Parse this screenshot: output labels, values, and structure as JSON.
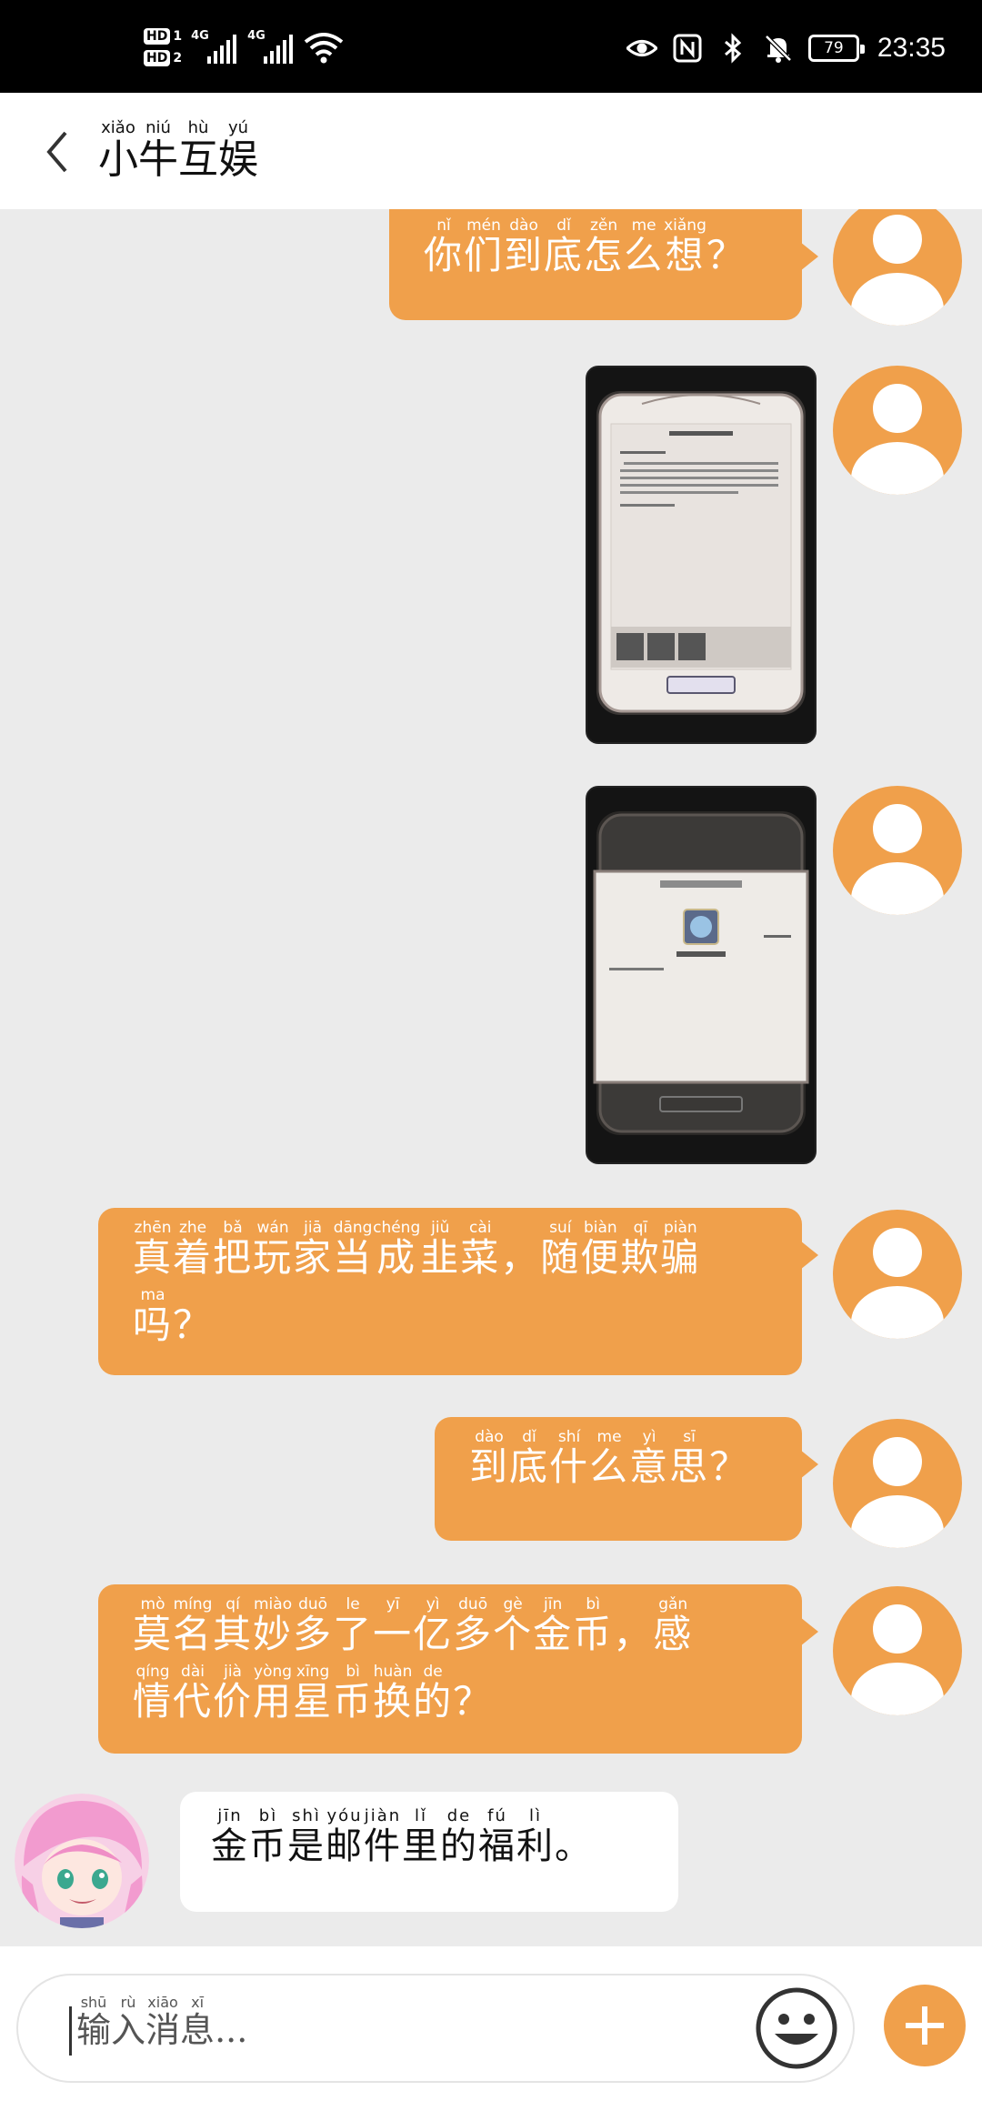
{
  "status_bar": {
    "hd1": "HD",
    "sim1": "1",
    "hd2": "HD",
    "sim2": "2",
    "net1": "4G",
    "net2": "4G",
    "battery": "79",
    "time": "23:35"
  },
  "header": {
    "back_icon": "chevron-left-icon",
    "title": [
      {
        "char": "小",
        "py": "xiǎo"
      },
      {
        "char": "牛",
        "py": "niú"
      },
      {
        "char": "互",
        "py": "hù"
      },
      {
        "char": "娱",
        "py": "yú"
      }
    ]
  },
  "messages": [
    {
      "id": "msg1",
      "type": "text",
      "from": "me",
      "lines": [
        [
          {
            "c": "你",
            "p": "nǐ"
          },
          {
            "c": "们",
            "p": "mén"
          },
          {
            "c": "到",
            "p": "dào"
          },
          {
            "c": "底",
            "p": "dǐ"
          },
          {
            "c": "怎",
            "p": "zěn"
          },
          {
            "c": "么",
            "p": "me"
          },
          {
            "c": "想",
            "p": "xiǎng"
          },
          {
            "c": "？",
            "p": ""
          }
        ]
      ]
    },
    {
      "id": "msg2",
      "type": "image",
      "from": "me",
      "description": "game mail screenshot"
    },
    {
      "id": "msg3",
      "type": "image",
      "from": "me",
      "description": "game reward screenshot"
    },
    {
      "id": "msg4",
      "type": "text",
      "from": "me",
      "lines": [
        [
          {
            "c": "真",
            "p": "zhēn"
          },
          {
            "c": "着",
            "p": "zhe"
          },
          {
            "c": "把",
            "p": "bǎ"
          },
          {
            "c": "玩",
            "p": "wán"
          },
          {
            "c": "家",
            "p": "jiā"
          },
          {
            "c": "当",
            "p": "dāng"
          },
          {
            "c": "成",
            "p": "chéng"
          },
          {
            "c": "韭",
            "p": "jiǔ"
          },
          {
            "c": "菜",
            "p": "cài"
          },
          {
            "c": "，",
            "p": ""
          },
          {
            "c": "随",
            "p": "suí"
          },
          {
            "c": "便",
            "p": "biàn"
          },
          {
            "c": "欺",
            "p": "qī"
          },
          {
            "c": "骗",
            "p": "piàn"
          }
        ],
        [
          {
            "c": "吗",
            "p": "ma"
          },
          {
            "c": "？",
            "p": ""
          }
        ]
      ]
    },
    {
      "id": "msg5",
      "type": "text",
      "from": "me",
      "lines": [
        [
          {
            "c": "到",
            "p": "dào"
          },
          {
            "c": "底",
            "p": "dǐ"
          },
          {
            "c": "什",
            "p": "shí"
          },
          {
            "c": "么",
            "p": "me"
          },
          {
            "c": "意",
            "p": "yì"
          },
          {
            "c": "思",
            "p": "sī"
          },
          {
            "c": "？",
            "p": ""
          }
        ]
      ]
    },
    {
      "id": "msg6",
      "type": "text",
      "from": "me",
      "lines": [
        [
          {
            "c": "莫",
            "p": "mò"
          },
          {
            "c": "名",
            "p": "míng"
          },
          {
            "c": "其",
            "p": "qí"
          },
          {
            "c": "妙",
            "p": "miào"
          },
          {
            "c": "多",
            "p": "duō"
          },
          {
            "c": "了",
            "p": "le"
          },
          {
            "c": "一",
            "p": "yī"
          },
          {
            "c": "亿",
            "p": "yì"
          },
          {
            "c": "多",
            "p": "duō"
          },
          {
            "c": "个",
            "p": "gè"
          },
          {
            "c": "金",
            "p": "jīn"
          },
          {
            "c": "币",
            "p": "bì"
          },
          {
            "c": "，",
            "p": ""
          },
          {
            "c": "感",
            "p": "gǎn"
          }
        ],
        [
          {
            "c": "情",
            "p": "qíng"
          },
          {
            "c": "代",
            "p": "dài"
          },
          {
            "c": "价",
            "p": "jià"
          },
          {
            "c": "用",
            "p": "yòng"
          },
          {
            "c": "星",
            "p": "xīng"
          },
          {
            "c": "币",
            "p": "bì"
          },
          {
            "c": "换",
            "p": "huàn"
          },
          {
            "c": "的",
            "p": "de"
          },
          {
            "c": "？",
            "p": ""
          }
        ]
      ]
    },
    {
      "id": "msg7",
      "type": "text",
      "from": "other",
      "lines": [
        [
          {
            "c": "金",
            "p": "jīn"
          },
          {
            "c": "币",
            "p": "bì"
          },
          {
            "c": "是",
            "p": "shì"
          },
          {
            "c": "邮",
            "p": "yóu"
          },
          {
            "c": "件",
            "p": "jiàn"
          },
          {
            "c": "里",
            "p": "lǐ"
          },
          {
            "c": "的",
            "p": "de"
          },
          {
            "c": "福",
            "p": "fú"
          },
          {
            "c": "利",
            "p": "lì"
          },
          {
            "c": "。",
            "p": ""
          }
        ]
      ]
    }
  ],
  "input": {
    "placeholder": [
      {
        "c": "输",
        "p": "shū"
      },
      {
        "c": "入",
        "p": "rù"
      },
      {
        "c": "消",
        "p": "xiāo"
      },
      {
        "c": "息",
        "p": "xī"
      },
      {
        "c": "...",
        "p": ""
      }
    ],
    "emoji_icon": "smiley-face-icon",
    "plus_icon": "plus-icon"
  },
  "colors": {
    "accent": "#f0a04b",
    "background": "#ebebeb",
    "status_bar": "#000000",
    "bubble_text": "#ffffff"
  }
}
